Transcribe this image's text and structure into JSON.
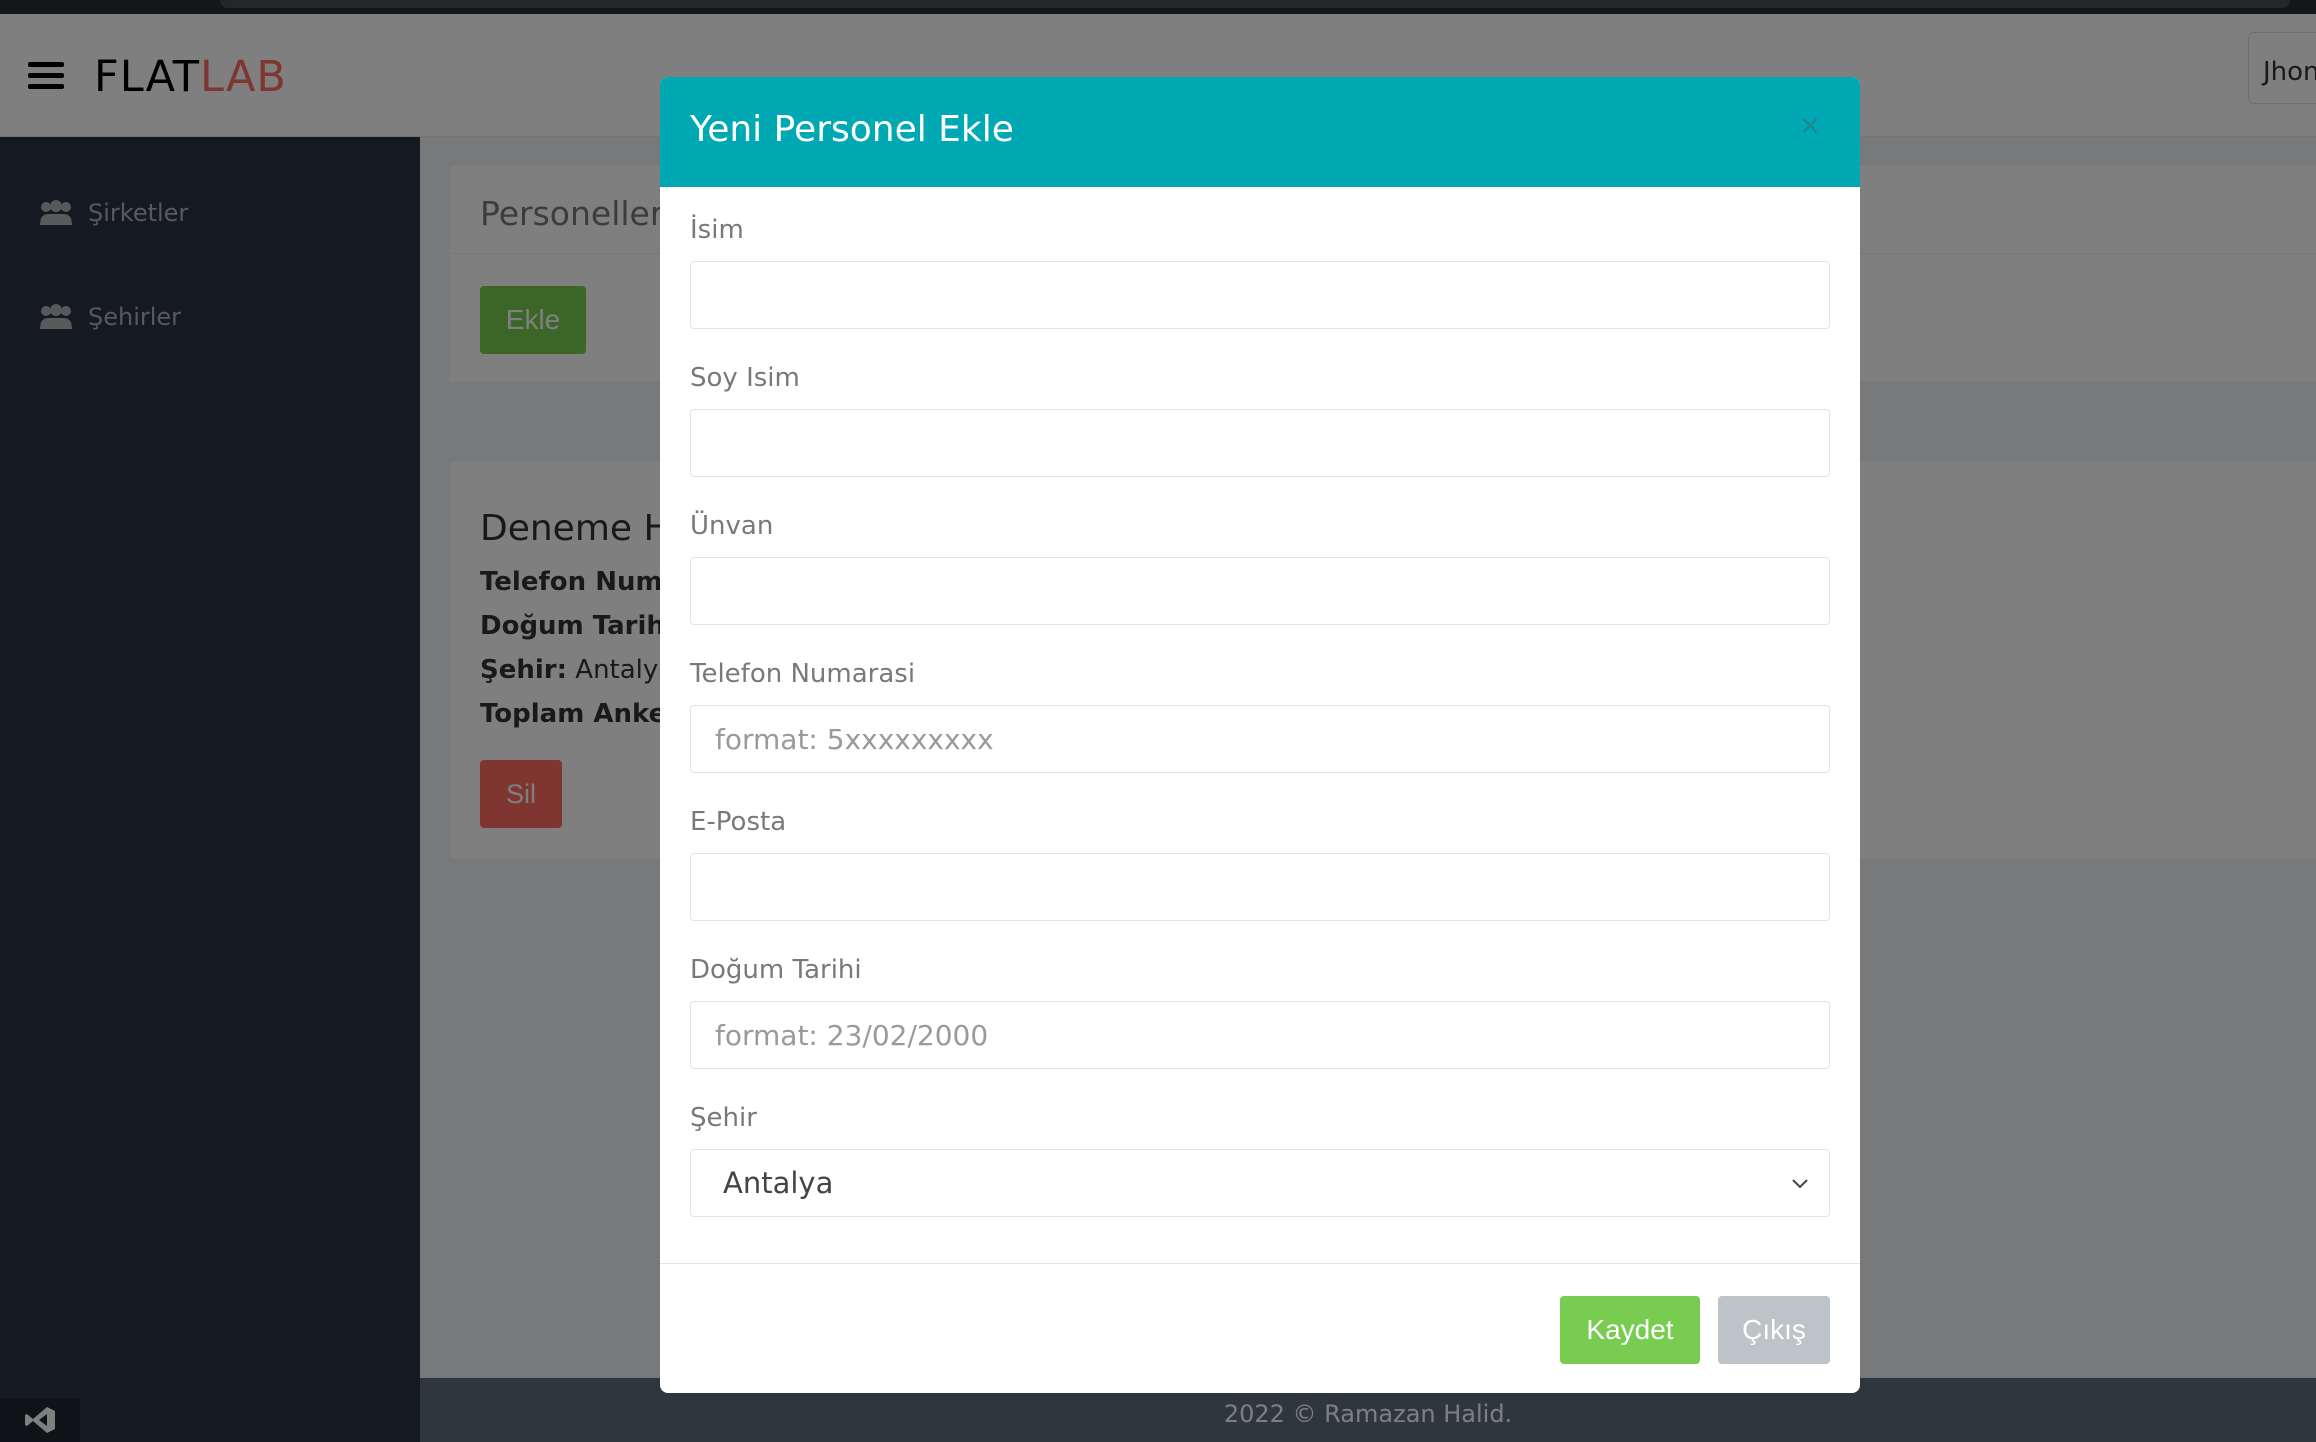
{
  "header": {
    "logo_primary": "FLAT",
    "logo_accent": "LAB",
    "user_name": "Jhon"
  },
  "sidebar": {
    "items": [
      {
        "label": "Şirketler",
        "icon": "users-icon"
      },
      {
        "label": "Şehirler",
        "icon": "users-icon"
      }
    ]
  },
  "main": {
    "panel_title": "Personeller",
    "add_button": "Ekle",
    "card": {
      "name": "Deneme H",
      "phone_label": "Telefon Numa",
      "birth_label": "Doğum Tarihi:",
      "city_label": "Şehir:",
      "city_value": "Antalya",
      "survey_label": "Toplam Anket",
      "delete_button": "Sil"
    }
  },
  "footer": {
    "text": "2022 © Ramazan Halid."
  },
  "modal": {
    "title": "Yeni Personel Ekle",
    "close": "×",
    "fields": {
      "name": {
        "label": "İsim",
        "value": "",
        "placeholder": ""
      },
      "surname": {
        "label": "Soy Isim",
        "value": "",
        "placeholder": ""
      },
      "title": {
        "label": "Ünvan",
        "value": "",
        "placeholder": ""
      },
      "phone": {
        "label": "Telefon Numarasi",
        "value": "",
        "placeholder": "format: 5xxxxxxxxx"
      },
      "email": {
        "label": "E-Posta",
        "value": "",
        "placeholder": ""
      },
      "birth": {
        "label": "Doğum Tarihi",
        "value": "",
        "placeholder": "format: 23/02/2000"
      },
      "city": {
        "label": "Şehir",
        "selected": "Antalya"
      }
    },
    "save_button": "Kaydet",
    "exit_button": "Çıkış"
  },
  "colors": {
    "modal_header": "#00a8b3",
    "success": "#78cd51",
    "danger": "#ff6c60",
    "sidebar": "#2a3542"
  }
}
